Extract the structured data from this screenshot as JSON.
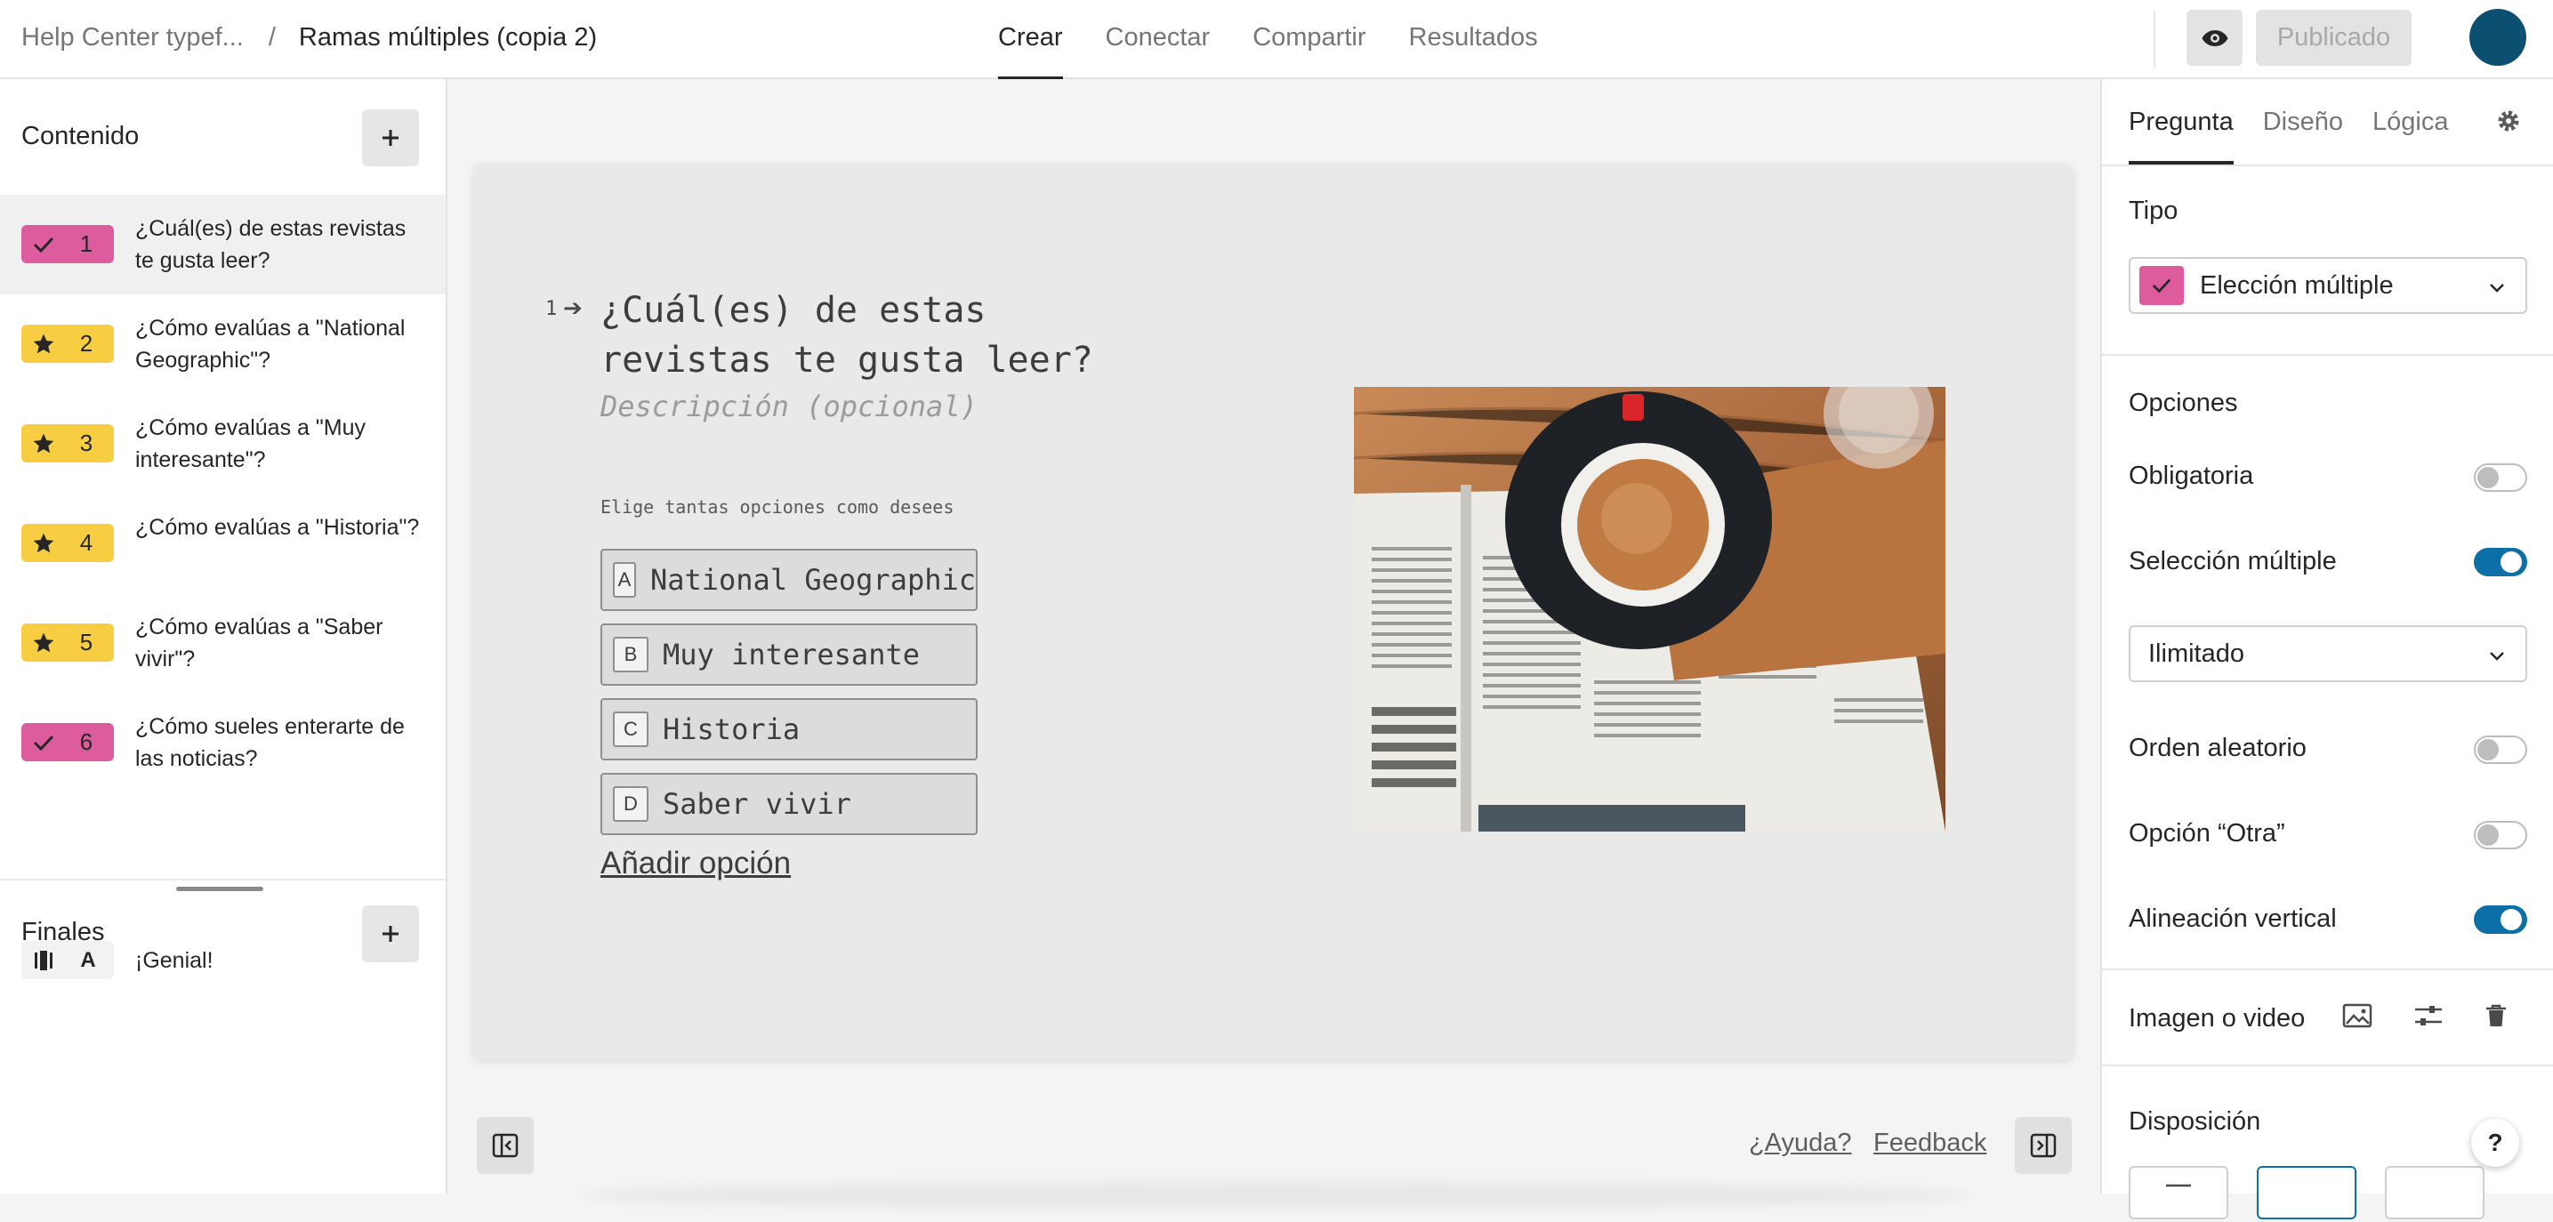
{
  "header": {
    "workspace": "Help Center typef...",
    "separator": "/",
    "form_title": "Ramas múltiples (copia 2)",
    "tabs": [
      "Crear",
      "Conectar",
      "Compartir",
      "Resultados"
    ],
    "active_tab": "Crear",
    "publish_label": "Publicado"
  },
  "sidebar": {
    "content_title": "Contenido",
    "questions": [
      {
        "num": "1",
        "type": "check",
        "text": "¿Cuál(es) de estas revistas te gusta leer?"
      },
      {
        "num": "2",
        "type": "star",
        "text": "¿Cómo evalúas a \"National Geographic\"?"
      },
      {
        "num": "3",
        "type": "star",
        "text": "¿Cómo evalúas a \"Muy interesante\"?"
      },
      {
        "num": "4",
        "type": "star",
        "text": "¿Cómo evalúas a \"Historia\"?"
      },
      {
        "num": "5",
        "type": "star",
        "text": "¿Cómo evalúas a \"Saber vivir\"?"
      },
      {
        "num": "6",
        "type": "check",
        "text": "¿Cómo sueles enterarte de las noticias?"
      }
    ],
    "endings_title": "Finales",
    "endings": [
      {
        "letter": "A",
        "text": "¡Genial!"
      }
    ]
  },
  "canvas": {
    "question_number": "1",
    "question_title": "¿Cuál(es) de estas revistas te gusta leer?",
    "description_placeholder": "Descripción (opcional)",
    "hint": "Elige tantas opciones como desees",
    "choices": [
      {
        "key": "A",
        "label": "National Geographic"
      },
      {
        "key": "B",
        "label": "Muy interesante"
      },
      {
        "key": "C",
        "label": "Historia"
      },
      {
        "key": "D",
        "label": "Saber vivir"
      }
    ],
    "add_option": "Añadir opción",
    "help_link": "¿Ayuda?",
    "feedback_link": "Feedback"
  },
  "panel": {
    "tabs": [
      "Pregunta",
      "Diseño",
      "Lógica"
    ],
    "active_tab": "Pregunta",
    "type_label": "Tipo",
    "type_value": "Elección múltiple",
    "options_label": "Opciones",
    "required_label": "Obligatoria",
    "required": false,
    "multi_label": "Selección múltiple",
    "multi": true,
    "limit_value": "Ilimitado",
    "random_label": "Orden aleatorio",
    "random": false,
    "other_label": "Opción “Otra”",
    "other": false,
    "vertical_label": "Alineación vertical",
    "vertical": true,
    "media_label": "Imagen o video",
    "layout_label": "Disposición",
    "help_button": "?"
  },
  "colors": {
    "multiple_choice": "#dd5c9d",
    "rating": "#f7cd41",
    "toggle_on": "#0d6fa8",
    "avatar": "#0b4f71"
  }
}
